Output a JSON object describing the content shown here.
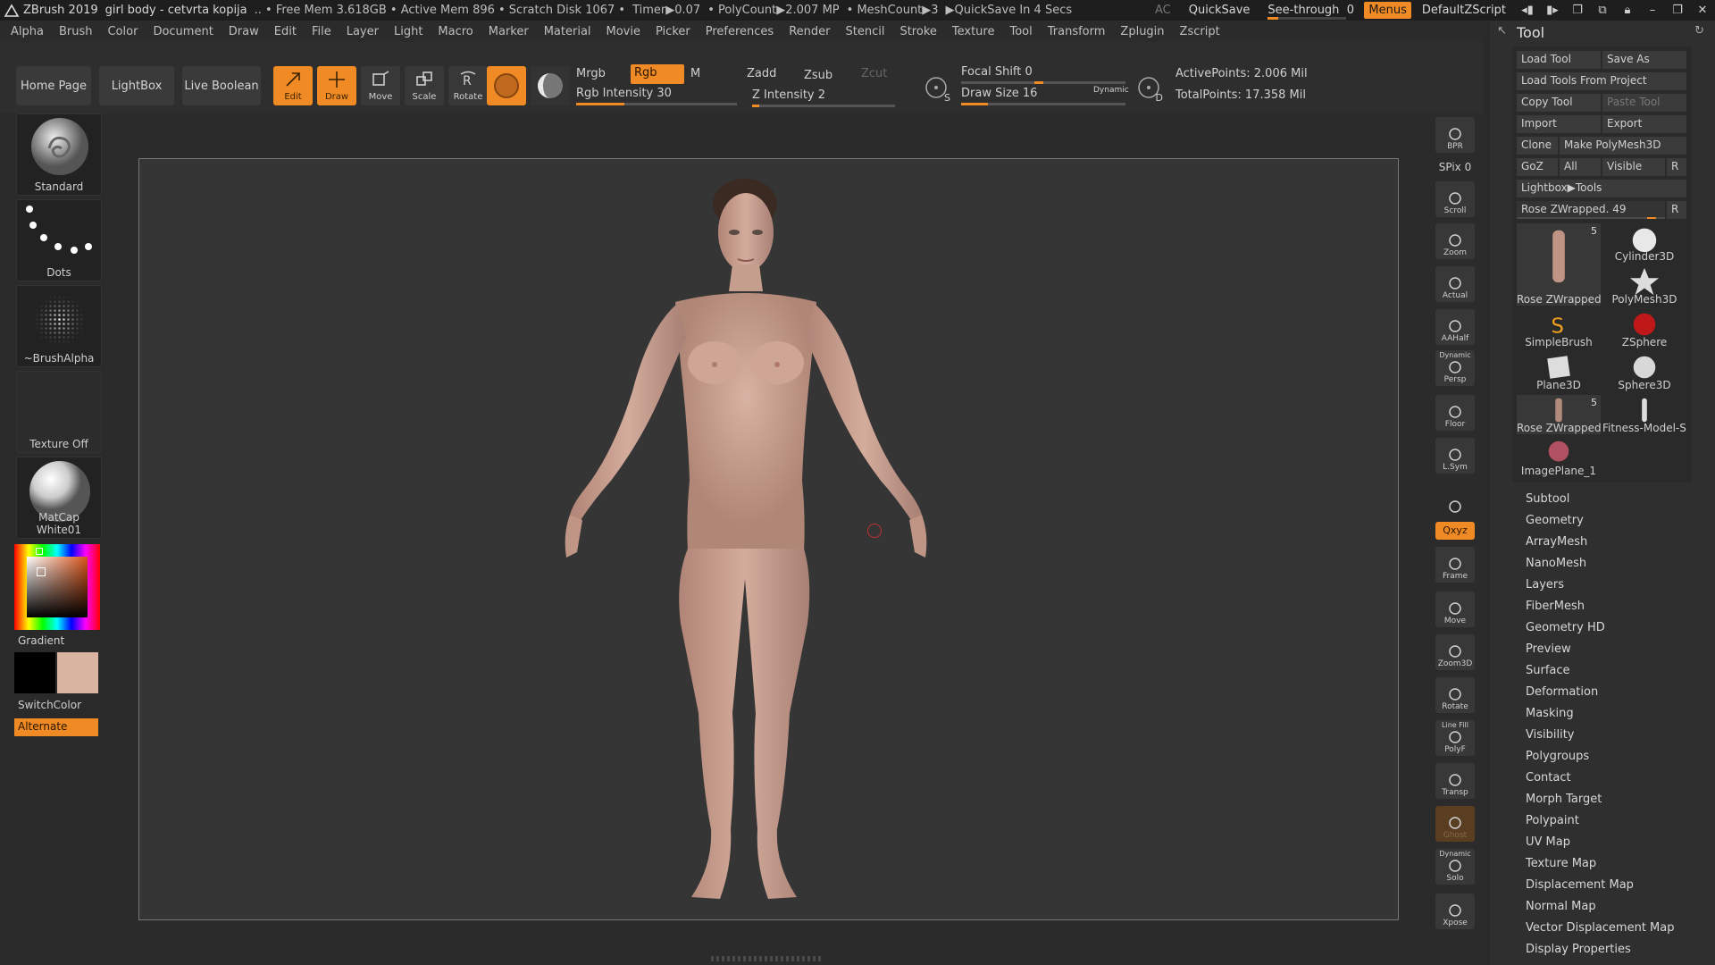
{
  "titlebar": {
    "app": "ZBrush 2019",
    "doc": "girl body - cetvrta kopija",
    "stats": ".. • Free Mem 3.618GB • Active Mem 896 • Scratch Disk 1067 •",
    "timer": "Timer▶0.07",
    "polycount": "• PolyCount▶2.007 MP",
    "meshcount": "• MeshCount▶3",
    "quicksave_in": "▶QuickSave In 4 Secs",
    "ac": "AC",
    "quicksave": "QuickSave",
    "see_through": "See-through",
    "see_through_value": "0",
    "see_through_level": 0.0,
    "menus": "Menus",
    "script": "DefaultZScript"
  },
  "menubar": [
    "Alpha",
    "Brush",
    "Color",
    "Document",
    "Draw",
    "Edit",
    "File",
    "Layer",
    "Light",
    "Macro",
    "Marker",
    "Material",
    "Movie",
    "Picker",
    "Preferences",
    "Render",
    "Stencil",
    "Stroke",
    "Texture",
    "Tool",
    "Transform",
    "Zplugin",
    "Zscript"
  ],
  "shelf": {
    "home": "Home Page",
    "lightbox": "LightBox",
    "live_boolean": "Live Boolean",
    "tools": [
      {
        "label": "Edit",
        "active": true
      },
      {
        "label": "Draw",
        "active": true
      },
      {
        "label": "Move",
        "active": false
      },
      {
        "label": "Scale",
        "active": false
      },
      {
        "label": "Rotate",
        "active": false
      }
    ],
    "mrgb": "Mrgb",
    "rgb": "Rgb",
    "m": "M",
    "rgb_intensity": "Rgb Intensity 30",
    "rgb_intensity_level": 0.3,
    "zadd": "Zadd",
    "zsub": "Zsub",
    "zcut": "Zcut",
    "z_intensity": "Z Intensity 2",
    "z_intensity_level": 0.02,
    "focal_shift": "Focal Shift 0",
    "draw_size": "Draw Size 16",
    "dynamic": "Dynamic",
    "active_points": "ActivePoints: 2.006 Mil",
    "total_points": "TotalPoints: 17.358 Mil",
    "s_label": "S",
    "d_label": "D"
  },
  "leftpanel": {
    "brush": "Standard",
    "stroke": "Dots",
    "alpha": "~BrushAlpha",
    "texture": "Texture Off",
    "material": "MatCap White01",
    "gradient": "Gradient",
    "switchcolor": "SwitchColor",
    "alternate": "Alternate",
    "primary_color": "#000000",
    "secondary_color": "#d9b4a0"
  },
  "righttoolbar": [
    {
      "label": "BPR",
      "icon": "bpr-icon"
    },
    {
      "label": "SPix 0",
      "icon": "spix-slider"
    },
    {
      "label": "Scroll",
      "icon": "scroll-icon"
    },
    {
      "label": "Zoom",
      "icon": "zoom-icon"
    },
    {
      "label": "Actual",
      "icon": "actual-icon"
    },
    {
      "label": "AAHalf",
      "icon": "aahalf-icon"
    },
    {
      "label": "Persp",
      "icon": "persp-icon",
      "top": "Dynamic"
    },
    {
      "label": "Floor",
      "icon": "floor-icon"
    },
    {
      "label": "L.Sym",
      "icon": "lsym-icon"
    },
    {
      "label": "",
      "icon": "lock-icon"
    },
    {
      "label": "Qxyz",
      "icon": "xyz-icon",
      "active": true
    },
    {
      "label": "Frame",
      "icon": "frame-icon"
    },
    {
      "label": "Move",
      "icon": "move-icon"
    },
    {
      "label": "Zoom3D",
      "icon": "zoom3d-icon"
    },
    {
      "label": "Rotate",
      "icon": "rotate-icon"
    },
    {
      "label": "PolyF",
      "icon": "polyf-icon",
      "top": "Line Fill"
    },
    {
      "label": "Transp",
      "icon": "transp-icon"
    },
    {
      "label": "Ghost",
      "icon": "ghost-icon"
    },
    {
      "label": "Solo",
      "icon": "solo-icon",
      "top": "Dynamic"
    },
    {
      "label": "Xpose",
      "icon": "xpose-icon"
    }
  ],
  "tool": {
    "title": "Tool",
    "load_tool": "Load Tool",
    "save_as": "Save As",
    "load_from_project": "Load Tools From Project",
    "copy_tool": "Copy Tool",
    "paste_tool": "Paste Tool",
    "import": "Import",
    "export": "Export",
    "clone": "Clone",
    "make_polymesh": "Make PolyMesh3D",
    "goz": "GoZ",
    "all": "All",
    "visible": "Visible",
    "r": "R",
    "lightbox_tools": "Lightbox▶Tools",
    "current": "Rose ZWrapped. 49",
    "current_level": 0.94,
    "thumbs": [
      {
        "label": "Rose ZWrapped",
        "count": "5"
      },
      {
        "label": "Cylinder3D",
        "count": ""
      },
      {
        "label": "PolyMesh3D",
        "count": ""
      },
      {
        "label": "SimpleBrush",
        "count": ""
      },
      {
        "label": "ZSphere",
        "count": ""
      },
      {
        "label": "Plane3D",
        "count": ""
      },
      {
        "label": "Sphere3D",
        "count": ""
      },
      {
        "label": "Rose ZWrapped",
        "count": "5"
      },
      {
        "label": "Fitness-Model-Sh",
        "count": ""
      },
      {
        "label": "ImagePlane_1",
        "count": ""
      }
    ],
    "sections": [
      "Subtool",
      "Geometry",
      "ArrayMesh",
      "NanoMesh",
      "Layers",
      "FiberMesh",
      "Geometry HD",
      "Preview",
      "Surface",
      "Deformation",
      "Masking",
      "Visibility",
      "Polygroups",
      "Contact",
      "Morph Target",
      "Polypaint",
      "UV Map",
      "Texture Map",
      "Displacement Map",
      "Normal Map",
      "Vector Displacement Map",
      "Display Properties"
    ]
  }
}
